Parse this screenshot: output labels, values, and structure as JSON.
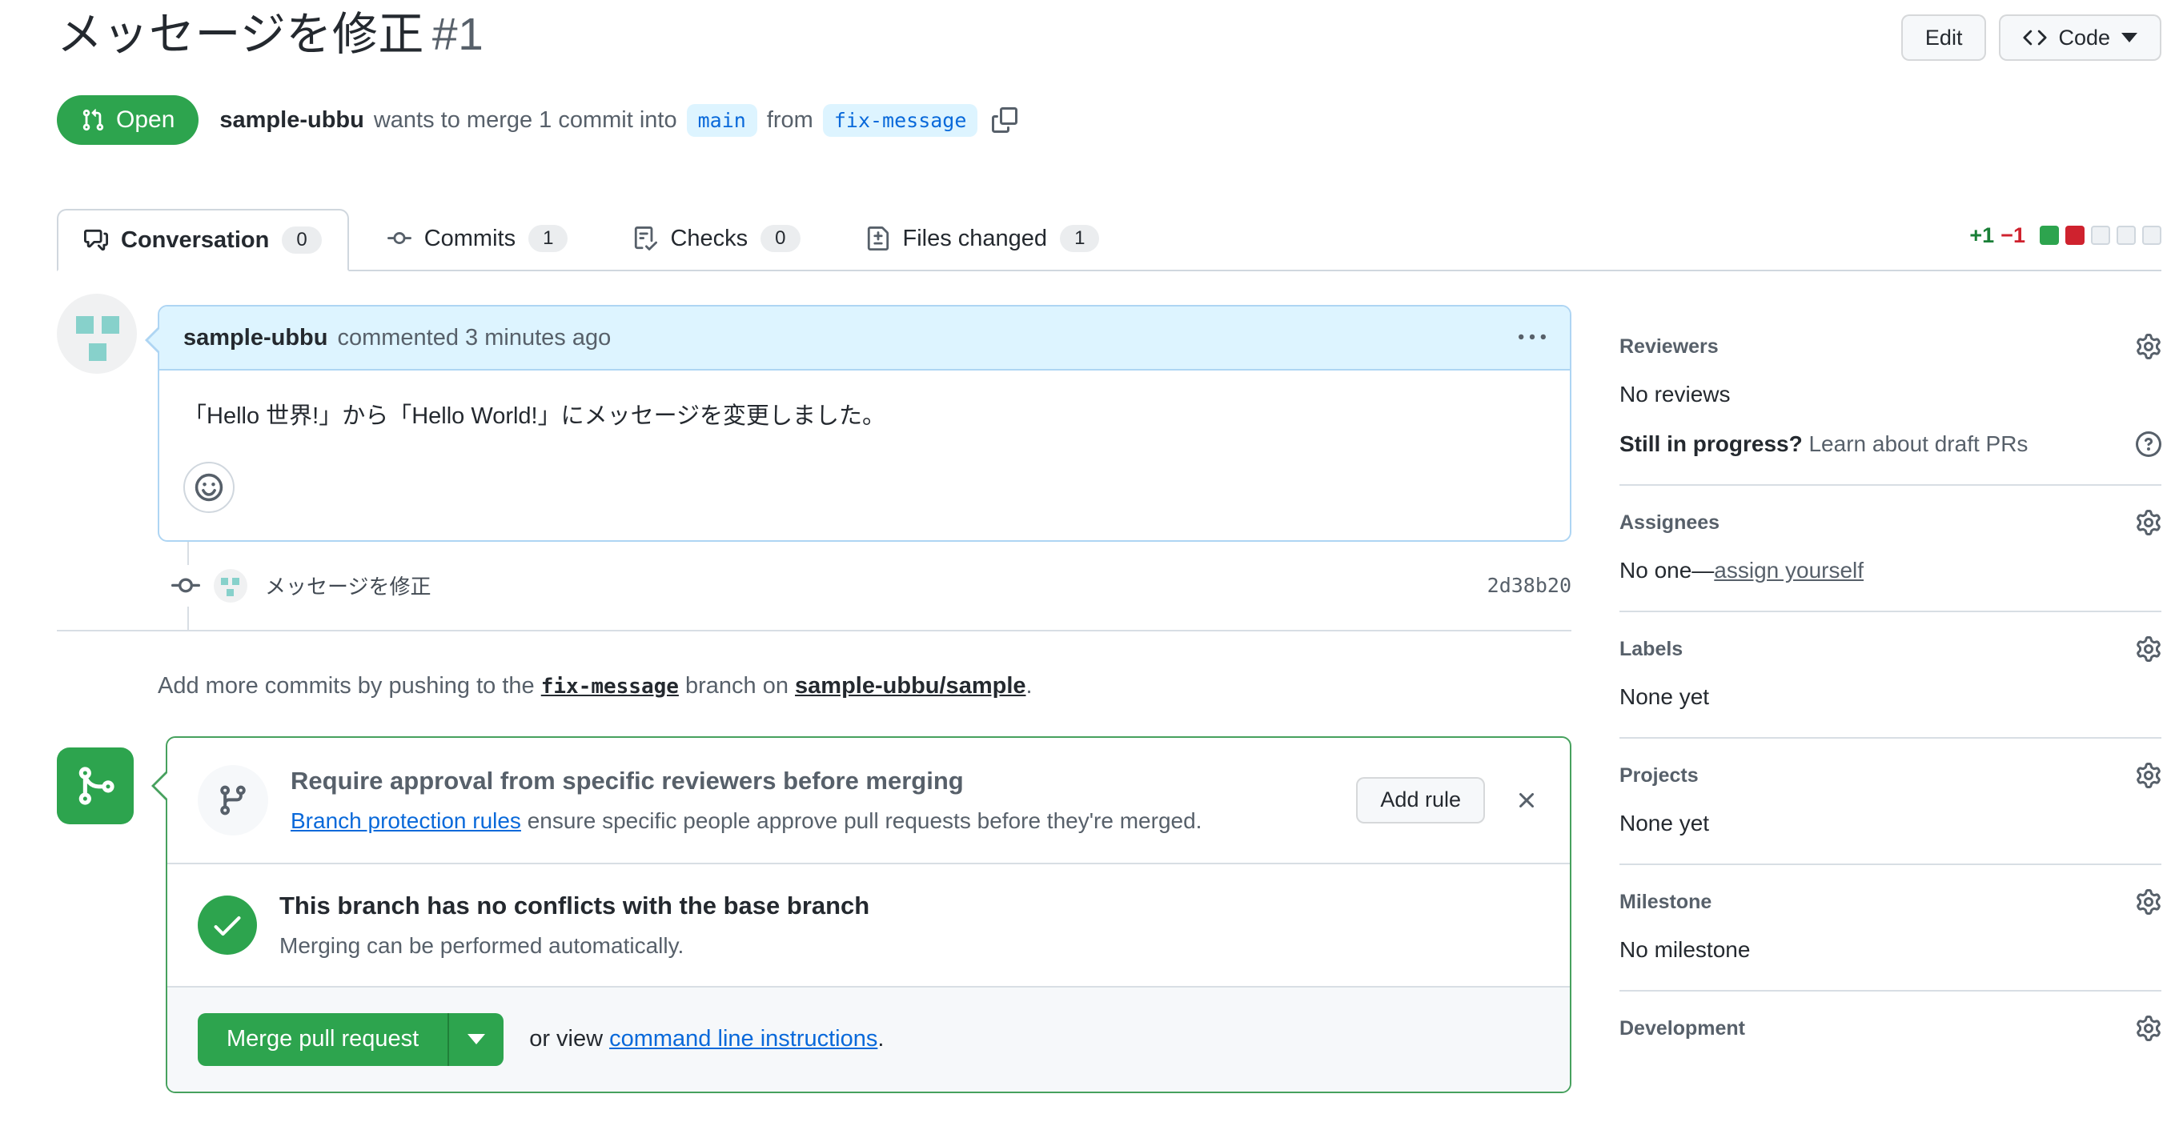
{
  "page": {
    "title": "メッセージを修正",
    "number": "#1"
  },
  "header": {
    "edit_label": "Edit",
    "code_label": "Code",
    "state": "Open",
    "author": "sample-ubbu",
    "merge_text_1": "wants to merge 1 commit into",
    "base_branch": "main",
    "merge_text_2": "from",
    "head_branch": "fix-message"
  },
  "tabs": {
    "conversation": {
      "label": "Conversation",
      "count": "0"
    },
    "commits": {
      "label": "Commits",
      "count": "1"
    },
    "checks": {
      "label": "Checks",
      "count": "0"
    },
    "files": {
      "label": "Files changed",
      "count": "1"
    }
  },
  "diffstat": {
    "additions": "+1",
    "deletions": "−1"
  },
  "comment": {
    "author": "sample-ubbu",
    "meta": "commented 3 minutes ago",
    "body": "「Hello 世界!」から「Hello World!」にメッセージを変更しました。"
  },
  "commit": {
    "message": "メッセージを修正",
    "sha": "2d38b20"
  },
  "push_hint": {
    "text_1": "Add more commits by pushing to the",
    "branch": "fix-message",
    "text_2": "branch on",
    "repo": "sample-ubbu/sample",
    "text_3": "."
  },
  "merge_box": {
    "protection": {
      "title": "Require approval from specific reviewers before merging",
      "link": "Branch protection rules",
      "description": "ensure specific people approve pull requests before they're merged.",
      "add_rule_label": "Add rule"
    },
    "status": {
      "title": "This branch has no conflicts with the base branch",
      "description": "Merging can be performed automatically."
    },
    "actions": {
      "merge_label": "Merge pull request",
      "or_view": "or view",
      "cli_link": "command line instructions",
      "period": "."
    }
  },
  "sidebar": {
    "reviewers": {
      "title": "Reviewers",
      "empty": "No reviews",
      "draft_bold": "Still in progress?",
      "draft_link": "Learn about draft PRs"
    },
    "assignees": {
      "title": "Assignees",
      "empty": "No one—",
      "link": "assign yourself"
    },
    "labels": {
      "title": "Labels",
      "empty": "None yet"
    },
    "projects": {
      "title": "Projects",
      "empty": "None yet"
    },
    "milestone": {
      "title": "Milestone",
      "empty": "No milestone"
    },
    "development": {
      "title": "Development"
    }
  },
  "colors": {
    "open_green": "#2da44e",
    "link_blue": "#0969da",
    "addition_green": "#1a7f37",
    "deletion_red": "#cf222e",
    "branch_pill_bg": "#ddf4ff"
  }
}
